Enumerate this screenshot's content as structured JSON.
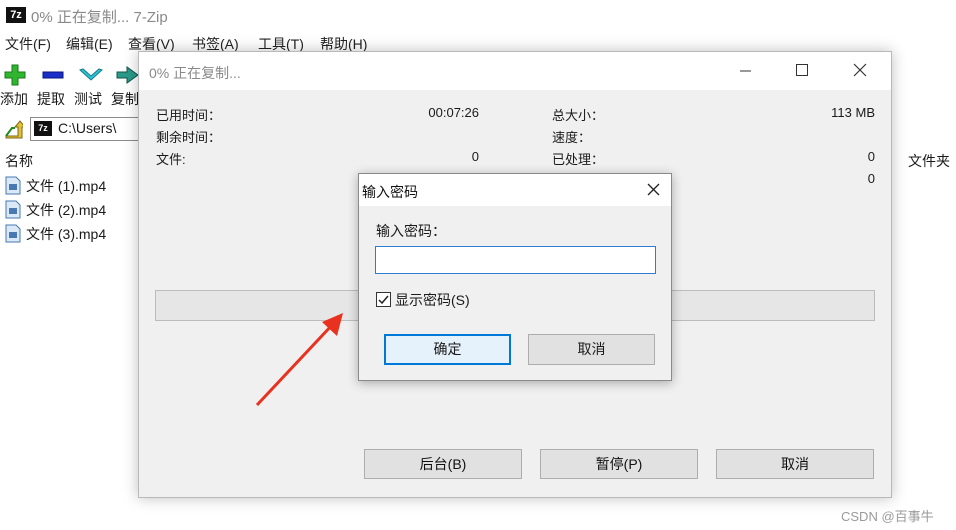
{
  "main_window": {
    "title": "0% 正在复制... 7-Zip",
    "logo_text": "7z",
    "menu": [
      "文件(F)",
      "编辑(E)",
      "查看(V)",
      "书签(A)",
      "工具(T)",
      "帮助(H)"
    ],
    "toolbar": [
      "添加",
      "提取",
      "测试",
      "复制"
    ],
    "address": "C:\\Users\\",
    "columns": {
      "name": "名称",
      "folder": "文件夹"
    },
    "files": [
      "文件 (1).mp4",
      "文件 (2).mp4",
      "文件 (3).mp4"
    ]
  },
  "progress_dialog": {
    "title": "0% 正在复制...",
    "left_stats": [
      {
        "label": "已用时间：",
        "value": "00:07:26"
      },
      {
        "label": "剩余时间：",
        "value": ""
      },
      {
        "label": "文件:",
        "value": "0"
      }
    ],
    "right_stats": [
      {
        "label": "总大小：",
        "value": "113 MB"
      },
      {
        "label": "速度：",
        "value": ""
      },
      {
        "label": "已处理：",
        "value": "0"
      },
      {
        "label": "",
        "value": "0"
      }
    ],
    "progress": 0,
    "buttons": {
      "background": "后台(B)",
      "pause": "暂停(P)",
      "cancel": "取消"
    }
  },
  "password_dialog": {
    "title": "输入密码",
    "prompt": "输入密码：",
    "password_value": "",
    "show_password_label": "显示密码(S)",
    "show_password_checked": true,
    "ok": "确定",
    "cancel": "取消"
  },
  "annotation": {
    "arrow_color": "#e8321f"
  },
  "watermark": "CSDN @百事牛"
}
